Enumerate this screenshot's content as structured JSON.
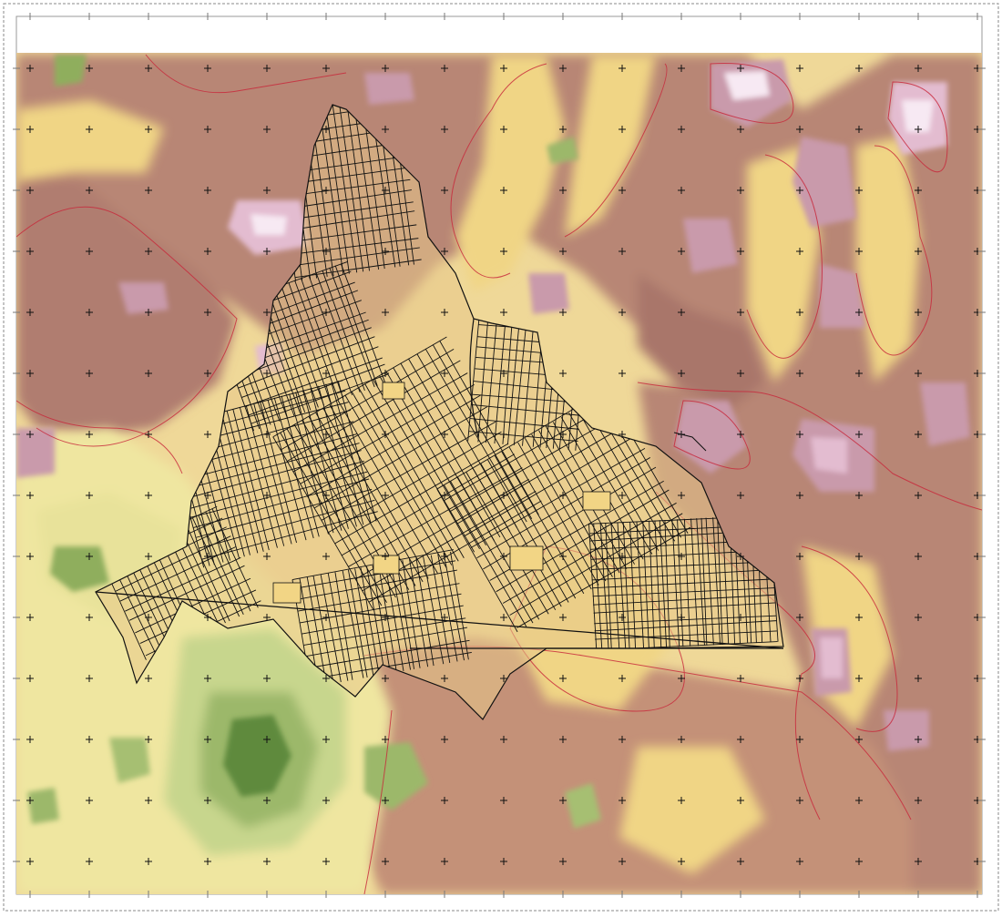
{
  "map": {
    "type": "elevation-raster-with-street-overlay",
    "colors": {
      "deep_green": "#5f8a3e",
      "green": "#9cb86a",
      "light_green": "#c7d68d",
      "pale_yellow": "#efe6a0",
      "yellow": "#f2d585",
      "tan": "#e6b77c",
      "brown": "#b88674",
      "dark_brown": "#a9766b",
      "mauve": "#c99aab",
      "pink": "#e3bcd0",
      "white_pink": "#f7e9f3",
      "contour_red": "#c8263a",
      "street_black": "#111111",
      "frame_gray": "#888888"
    },
    "has_graticule_crosses": true,
    "has_street_network_overlay": true,
    "has_contour_lines": true
  }
}
